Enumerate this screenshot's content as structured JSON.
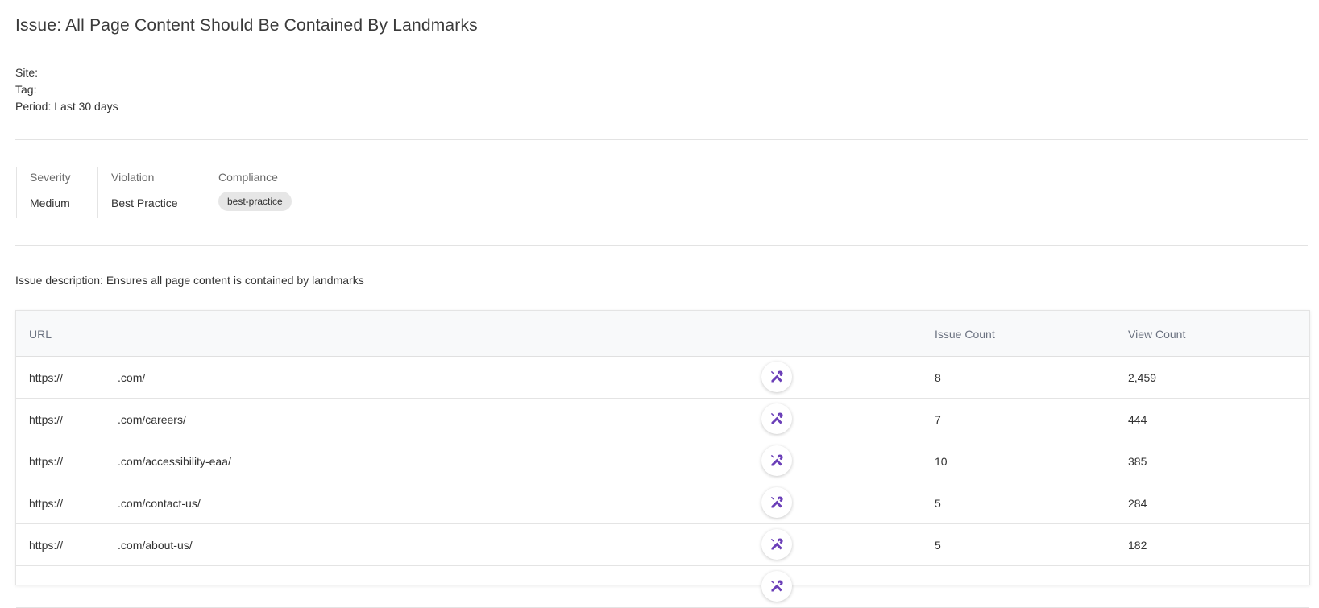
{
  "page": {
    "title": "Issue: All Page Content Should Be Contained By Landmarks",
    "site_label": "Site:",
    "tag_label": "Tag:",
    "period_label": "Period: Last 30 days"
  },
  "properties": {
    "severity": {
      "label": "Severity",
      "value": "Medium"
    },
    "violation": {
      "label": "Violation",
      "value": "Best Practice"
    },
    "compliance": {
      "label": "Compliance",
      "chip": "best-practice"
    }
  },
  "description": "Issue description: Ensures all page content is contained by landmarks",
  "table": {
    "columns": {
      "url": "URL",
      "issue_count": "Issue Count",
      "view_count": "View Count"
    },
    "rows": [
      {
        "url_prefix": "https://",
        "url_suffix": ".com/",
        "issue_count": "8",
        "view_count": "2,459"
      },
      {
        "url_prefix": "https://",
        "url_suffix": ".com/careers/",
        "issue_count": "7",
        "view_count": "444"
      },
      {
        "url_prefix": "https://",
        "url_suffix": ".com/accessibility-eaa/",
        "issue_count": "10",
        "view_count": "385"
      },
      {
        "url_prefix": "https://",
        "url_suffix": ".com/contact-us/",
        "issue_count": "5",
        "view_count": "284"
      },
      {
        "url_prefix": "https://",
        "url_suffix": ".com/about-us/",
        "issue_count": "5",
        "view_count": "182"
      }
    ]
  },
  "colors": {
    "accent": "#6b3fb8",
    "chip_bg": "#e6e6e6",
    "header_bg": "#f8f9fa"
  },
  "icons": {
    "fix_button": "tools-icon"
  }
}
